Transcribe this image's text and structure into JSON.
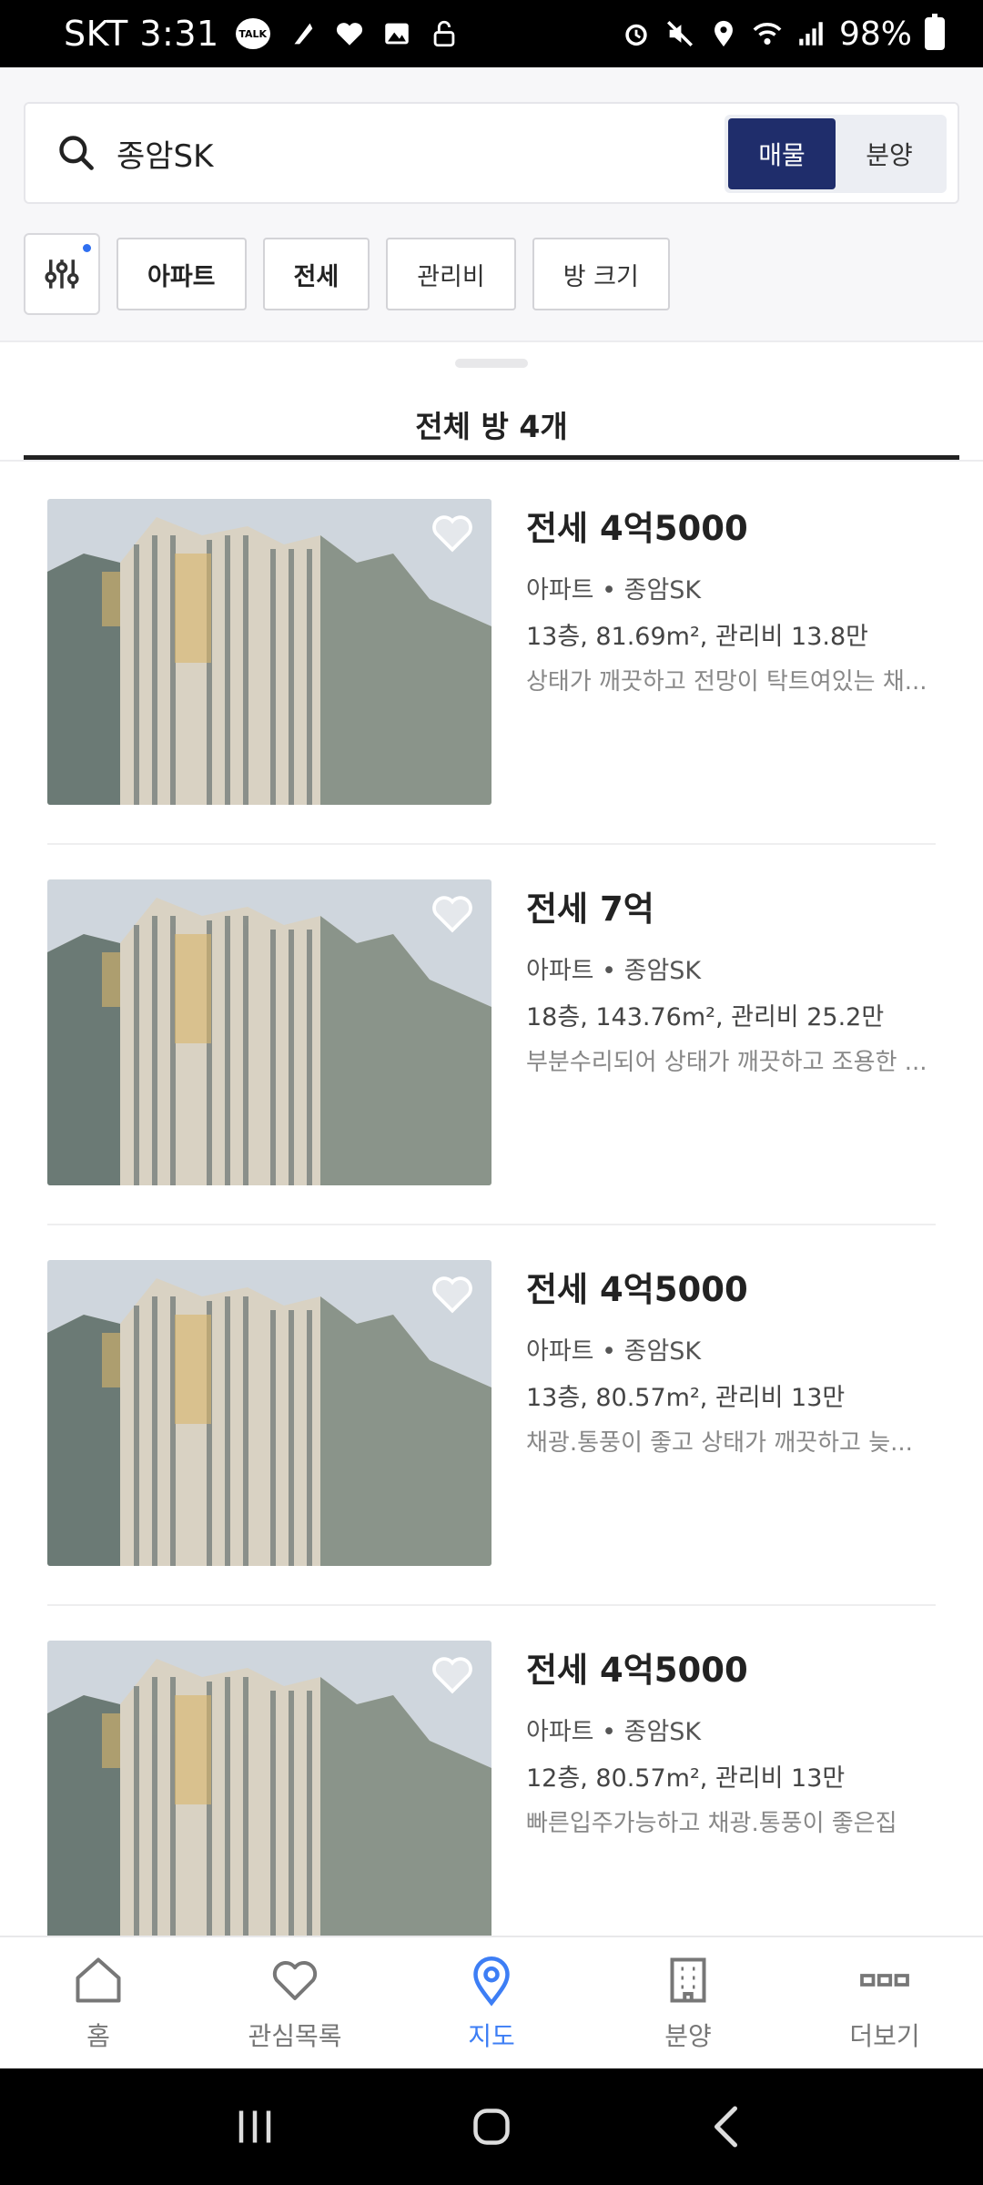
{
  "status_bar": {
    "carrier_time": "SKT 3:31",
    "talk_badge": "TALK",
    "battery": "98%"
  },
  "search": {
    "query": "종암SK",
    "segment_active": "매물",
    "segment_inactive": "분양"
  },
  "filters": {
    "chips": [
      "아파트",
      "전세",
      "관리비",
      "방 크기"
    ]
  },
  "list_header": {
    "title": "전체 방 4개"
  },
  "listings": [
    {
      "price": "전세 4억5000",
      "type": "아파트 • 종암SK",
      "spec": "13층, 81.69m², 관리비 13.8만",
      "desc": "상태가 깨끗하고 전망이 탁트여있는 채..."
    },
    {
      "price": "전세 7억",
      "type": "아파트 • 종암SK",
      "spec": "18층, 143.76m², 관리비 25.2만",
      "desc": "부분수리되어 상태가 깨끗하고 조용한 ..."
    },
    {
      "price": "전세 4억5000",
      "type": "아파트 • 종암SK",
      "spec": "13층, 80.57m², 관리비 13만",
      "desc": "채광.통풍이 좋고 상태가 깨끗하고 늦..."
    },
    {
      "price": "전세 4억5000",
      "type": "아파트 • 종암SK",
      "spec": "12층, 80.57m², 관리비 13만",
      "desc": "빠른입주가능하고 채광.통풍이 좋은집"
    }
  ],
  "bottom_nav": [
    {
      "label": "홈",
      "icon": "home-icon"
    },
    {
      "label": "관심목록",
      "icon": "heart-icon"
    },
    {
      "label": "지도",
      "icon": "map-pin-icon",
      "active": true
    },
    {
      "label": "분양",
      "icon": "building-icon"
    },
    {
      "label": "더보기",
      "icon": "more-icon"
    }
  ],
  "colors": {
    "accent_navy": "#1f2d6b",
    "active_blue": "#3d7ef5"
  }
}
